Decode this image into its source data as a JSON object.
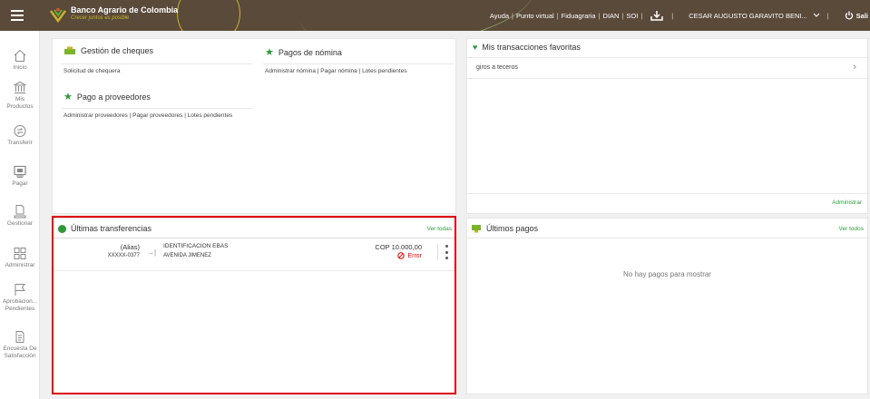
{
  "header": {
    "bank_name": "Banco Agrario de Colombia",
    "tagline": "Crecer juntos es posible",
    "links": [
      "Ayuda",
      "Punto virtual",
      "Fiduagraria",
      "DIAN",
      "SOI"
    ],
    "user": "CESAR AUGUSTO GARAVITO BENI...",
    "exit_label": "Sali"
  },
  "sidebar": {
    "items": [
      {
        "label": "Inicio",
        "icon": "home-icon"
      },
      {
        "label": "Mis Productos",
        "icon": "bank-icon"
      },
      {
        "label": "Transferir",
        "icon": "transfer-icon"
      },
      {
        "label": "Pagar",
        "icon": "pay-icon"
      },
      {
        "label": "Gestionar",
        "icon": "manage-icon"
      },
      {
        "label": "Administrar",
        "icon": "admin-grid-icon"
      },
      {
        "label": "Aprobacion... Pendientes",
        "icon": "flag-icon"
      },
      {
        "label": "Encuesta De Satisfacción",
        "icon": "survey-icon"
      }
    ]
  },
  "shortcuts": {
    "cheques": {
      "title": "Gestión de cheques",
      "links": "Solicitud de chequera"
    },
    "nomina": {
      "title": "Pagos de nómina",
      "links": "Administrar nómina | Pagar nómina | Lotes pendientes"
    },
    "proveedores": {
      "title": "Pago a proveedores",
      "links": "Administrar proveedores | Pagar proveedores | Lotes pendientes"
    }
  },
  "favorites": {
    "title": "Mis transacciones favoritas",
    "items": [
      "giros a teceros"
    ],
    "admin_link": "Administrar"
  },
  "transfers": {
    "title": "Últimas transferencias",
    "see_all": "Ver todas",
    "rows": [
      {
        "alias": "(Alias)",
        "account": "XXXXX-0377",
        "dest_id": "IDENTIFICACION EBAS",
        "dest_name": "AVENIDA JIMENEZ",
        "amount": "COP 10.000,00",
        "status": "Error"
      }
    ]
  },
  "payments": {
    "title": "Últimos pagos",
    "see_all": "Ver todos",
    "empty": "No hay pagos para mostrar"
  },
  "colors": {
    "header": "#5a4a3a",
    "accent_green": "#2e9a3a",
    "error_red": "#e00000",
    "gold": "#c8b22a"
  }
}
